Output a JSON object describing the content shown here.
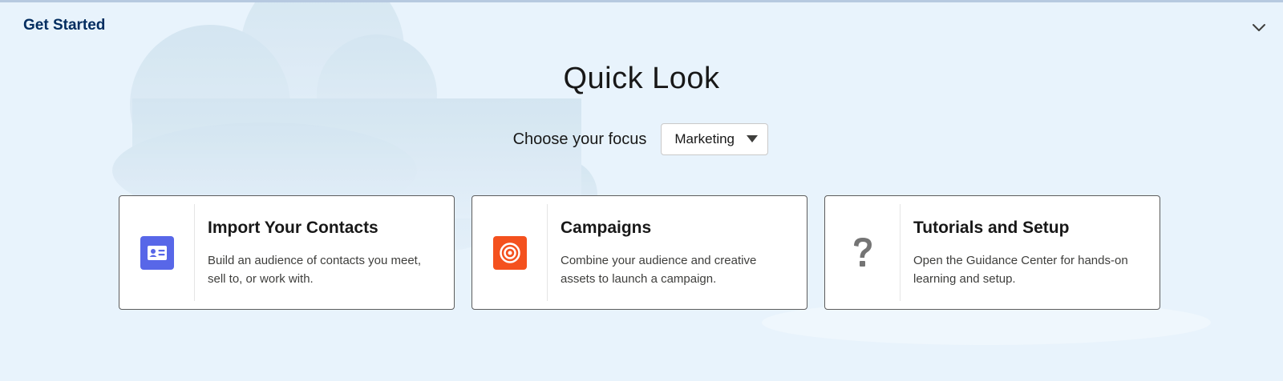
{
  "header": {
    "title": "Get Started"
  },
  "main": {
    "title": "Quick Look",
    "focus": {
      "label": "Choose your focus",
      "selected": "Marketing"
    },
    "cards": [
      {
        "title": "Import Your Contacts",
        "description": "Build an audience of contacts you meet, sell to, or work with.",
        "icon": "contact-card-icon",
        "icon_color": "#5867e8"
      },
      {
        "title": "Campaigns",
        "description": "Combine your audience and creative assets to launch a campaign.",
        "icon": "target-icon",
        "icon_color": "#f4511e"
      },
      {
        "title": "Tutorials and Setup",
        "description": "Open the Guidance Center for hands-on learning and setup.",
        "icon": "question-icon",
        "icon_color": "#747474"
      }
    ]
  },
  "colors": {
    "background": "#e8f3fc",
    "header_text": "#032d60"
  }
}
